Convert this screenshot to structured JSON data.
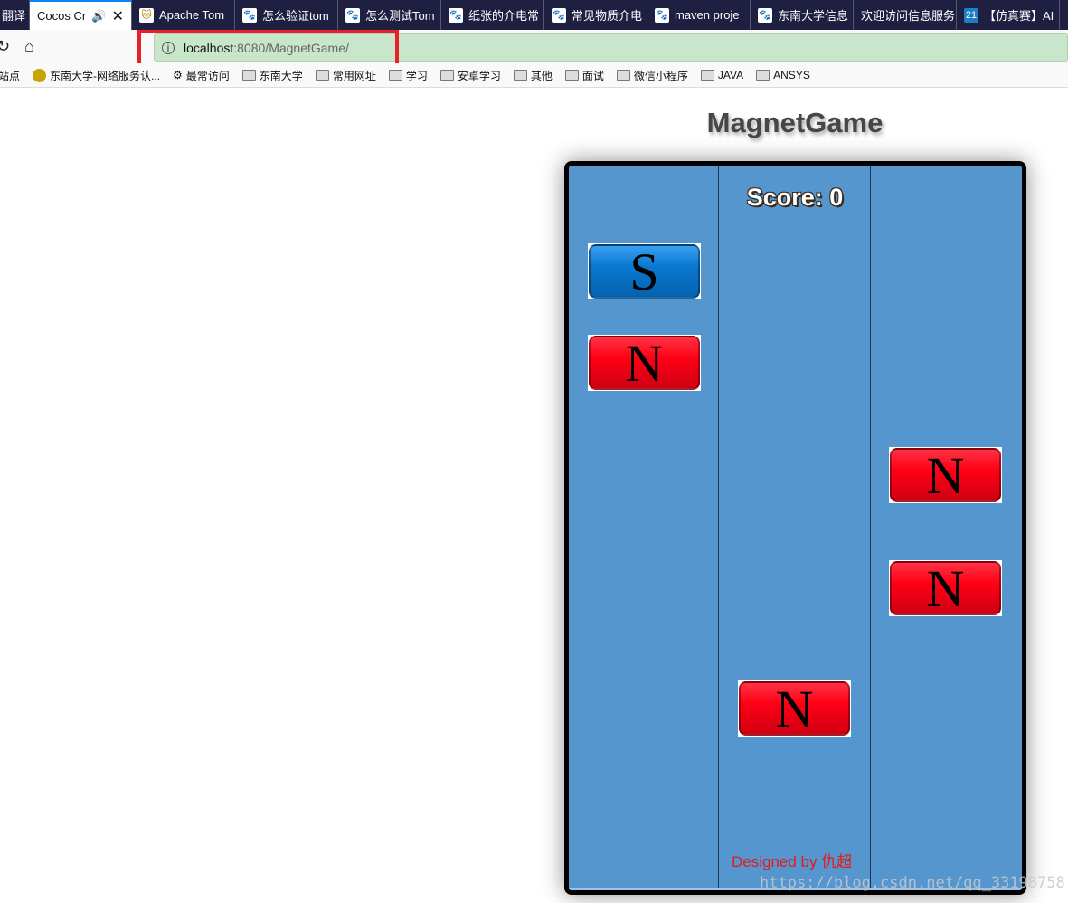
{
  "browser": {
    "tabs": [
      {
        "label": "翻译",
        "active": false,
        "icon": ""
      },
      {
        "label": "Cocos Cre",
        "active": true,
        "icon": "speaker-icon"
      },
      {
        "label": "Apache Tom",
        "active": false,
        "icon": "tomcat-icon"
      },
      {
        "label": "怎么验证tom",
        "active": false,
        "icon": "baidu-paw-icon"
      },
      {
        "label": "怎么测试Tom",
        "active": false,
        "icon": "baidu-paw-icon"
      },
      {
        "label": "纸张的介电常",
        "active": false,
        "icon": "baidu-paw-icon"
      },
      {
        "label": "常见物质介电",
        "active": false,
        "icon": "baidu-paw-icon"
      },
      {
        "label": "maven proje",
        "active": false,
        "icon": "baidu-paw-icon"
      },
      {
        "label": "东南大学信息",
        "active": false,
        "icon": "baidu-paw-icon"
      },
      {
        "label": "欢迎访问信息服务",
        "active": false,
        "icon": ""
      },
      {
        "label": "【仿真赛】AI",
        "active": false,
        "icon": "21-icon"
      }
    ],
    "url_host": "localhost",
    "url_rest": ":8080/MagnetGame/",
    "bookmarks": [
      "站点",
      "东南大学-网络服务认...",
      "最常访问",
      "东南大学",
      "常用网址",
      "学习",
      "安卓学习",
      "其他",
      "面试",
      "微信小程序",
      "JAVA",
      "ANSYS"
    ]
  },
  "page": {
    "title": "MagnetGame"
  },
  "game": {
    "score_text": "Score: 0",
    "credit": "Designed by 仇超",
    "magnets": [
      {
        "pole": "S",
        "lane": 1
      },
      {
        "pole": "N",
        "lane": 1
      },
      {
        "pole": "N",
        "lane": 3
      },
      {
        "pole": "N",
        "lane": 3
      },
      {
        "pole": "N",
        "lane": 2
      }
    ],
    "colors": {
      "background": "#5596cf",
      "north": "#ff0016",
      "south": "#0a78d0",
      "highlight": "#e8202a"
    }
  },
  "watermark": "https://blog.csdn.net/qq_33198758"
}
